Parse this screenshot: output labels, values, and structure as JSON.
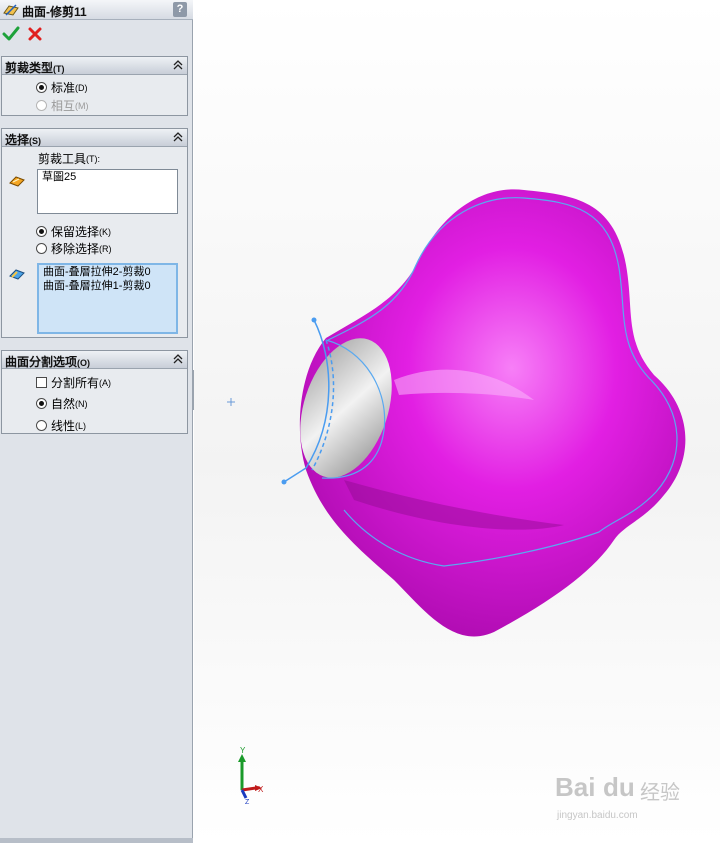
{
  "window": {
    "title": "曲面-修剪11",
    "help_label": "?"
  },
  "actions": {
    "ok_icon": "green-check-icon",
    "cancel_icon": "red-x-icon"
  },
  "trim_type": {
    "header": "剪裁类型",
    "header_hint": "(T)",
    "options": [
      {
        "label": "标准",
        "hint": "(D)",
        "selected": true,
        "enabled": true
      },
      {
        "label": "相互",
        "hint": "(M)",
        "selected": false,
        "enabled": false
      }
    ]
  },
  "selections": {
    "header": "选择",
    "header_hint": "(S)",
    "trim_tool_label": "剪裁工具",
    "trim_tool_hint": "(T):",
    "trim_tool_value": "草圖25",
    "keep_option": {
      "label": "保留选择",
      "hint": "(K)",
      "selected": true
    },
    "remove_option": {
      "label": "移除选择",
      "hint": "(R)",
      "selected": false
    },
    "pieces": [
      "曲面-叠層拉伸2-剪裁0",
      "曲面-叠層拉伸1-剪裁0"
    ]
  },
  "split_options": {
    "header": "曲面分割选项",
    "header_hint": "(O)",
    "split_all": {
      "label": "分割所有",
      "hint": "(A)",
      "checked": false
    },
    "natural": {
      "label": "自然",
      "hint": "(N)",
      "selected": true
    },
    "linear": {
      "label": "线性",
      "hint": "(L)",
      "selected": false
    }
  },
  "viewport": {
    "surface_color": "#e418e6",
    "cap_color": "#c9c9c9",
    "edge_color": "#4ea3f0",
    "triad": {
      "y": "Y",
      "x": "X",
      "z": "Z"
    }
  },
  "watermark": {
    "brand": "Bai",
    "brand2": "du",
    "cn": "经验",
    "url": "jingyan.baidu.com"
  }
}
